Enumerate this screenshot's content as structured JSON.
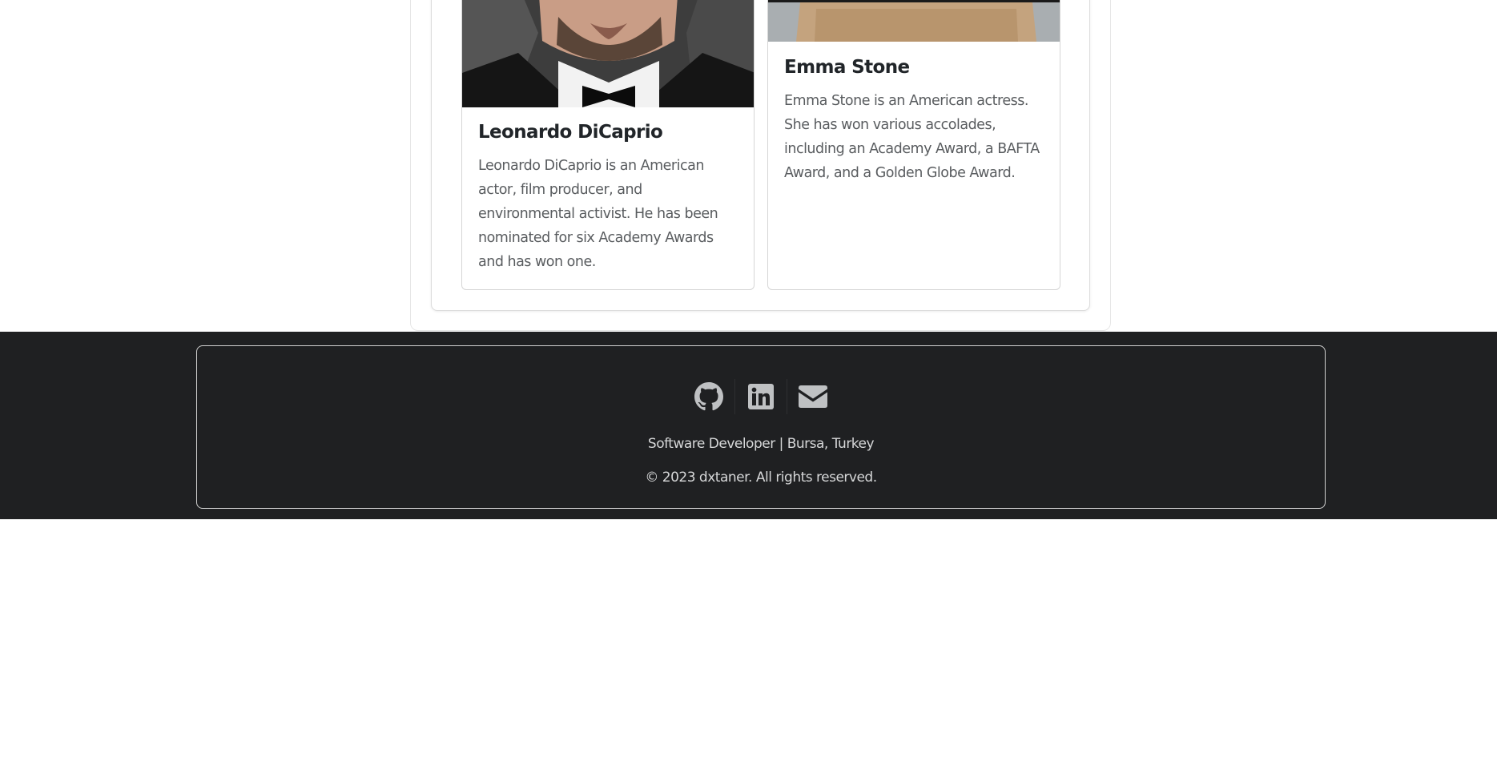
{
  "actors": [
    {
      "name": "Leonardo DiCaprio",
      "bio": "Leonardo DiCaprio is an American actor, film producer, and environmental activist. He has been nominated for six Academy Awards and has won one."
    },
    {
      "name": "Emma Stone",
      "bio": "Emma Stone is an American actress. She has won various accolades, including an Academy Award, a BAFTA Award, and a Golden Globe Award."
    }
  ],
  "footer": {
    "social": [
      {
        "icon": "github-icon"
      },
      {
        "icon": "linkedin-icon"
      },
      {
        "icon": "envelope-icon"
      }
    ],
    "tagline": "Software Developer | Bursa, Turkey",
    "copyright": "© 2023 dxtaner. All rights reserved."
  },
  "colors": {
    "footer_bg": "#1f2022",
    "icon": "#bfc1c3",
    "title": "#212529",
    "text": "#595c5f"
  }
}
